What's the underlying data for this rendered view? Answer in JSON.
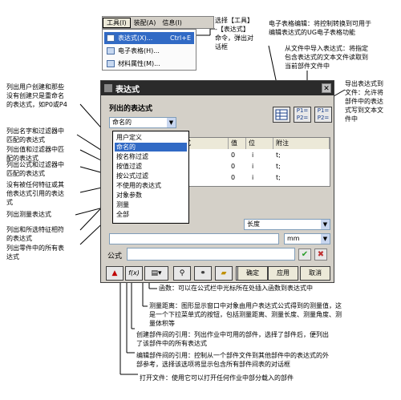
{
  "menu": {
    "tools": "工具(I)",
    "assembly": "装配(A)",
    "info": "信息(I)",
    "items": [
      {
        "label": "表达式(X)...",
        "shortcut": "Ctrl+E"
      },
      {
        "label": "电子表格(H)...",
        "shortcut": ""
      },
      {
        "label": "材料属性(M)...",
        "shortcut": ""
      }
    ]
  },
  "dialog": {
    "title": "表达式",
    "list_group_label": "列出的表达式",
    "filter_value": "命名的",
    "filter_options": [
      "用户定义",
      "命名的",
      "按名称过滤",
      "按值过滤",
      "按公式过滤",
      "不使用的表达式",
      "对象参数",
      "测量",
      "全部"
    ],
    "table_headers": [
      "式",
      "值",
      "位",
      "附注"
    ],
    "table_rows": [
      {
        "value": "0",
        "unit": "i",
        "note": "t;"
      },
      {
        "value": "0",
        "unit": "i",
        "note": "t;"
      },
      {
        "value": "0",
        "unit": "i",
        "note": "t;"
      }
    ],
    "type_value": "长度",
    "unit_value": "mm",
    "formula_label": "公式",
    "ok": "确定",
    "apply": "应用",
    "cancel": "取消",
    "func_label": "f(x)",
    "toolbar_import": "P1=\nP2=",
    "toolbar_export": "P1=\nP2="
  },
  "annotations": {
    "select_tools": "选择【工具】\n-【表达式】\n命令，弹出对\n话框",
    "spreadsheet": "电子表格编辑：将控制转换到可用于\n编辑表达式的UG电子表格功能",
    "import_file": "从文件中导入表达式：将指定\n包含表达式的文本文件读取到\n当前部件文件中",
    "export_file": "导出表达式到\n文件：允许将\n部件中的表达\n式写到文本文\n件中",
    "user_defined": "列出用户创建和那些\n没有创建只是重命名\n的表达式，如P0或P4",
    "by_name": "列出名字和过滤器中\n匹配的表达式",
    "by_value": "列出值和过滤器中匹\n配的表达式",
    "by_formula": "列出公式和过滤器中\n匹配的表达式",
    "unused": "没有被任何特征或其\n他表达式引用的表达\n式",
    "measure": "列出测量表达式",
    "object_params": "列出和所选特征相符\n的表达式",
    "all": "列出零件中的所有表\n达式",
    "function": "函数：可以在公式栏中光标所在处插入函数到表达式中",
    "measure_distance": "测量距离：图形显示窗口中对象由用户表达式公式得到的测量值，这\n是一个下拉菜单式的按钮，包括测量距离、测量长度、测量角度、测\n量体积等",
    "interpart": "创建部件间的引用：列出作业中可用的部件，选择了部件后，便列出\n了该部件中的所有表达式",
    "edit_interpart": "编辑部件间的引用：控制从一个部件文件到其他部件中的表达式的外\n部参考，选择该选项将显示包含所有部件间表的对话框",
    "open_file": "打开文件：使用它可以打开任何作业中部分载入的部件"
  }
}
